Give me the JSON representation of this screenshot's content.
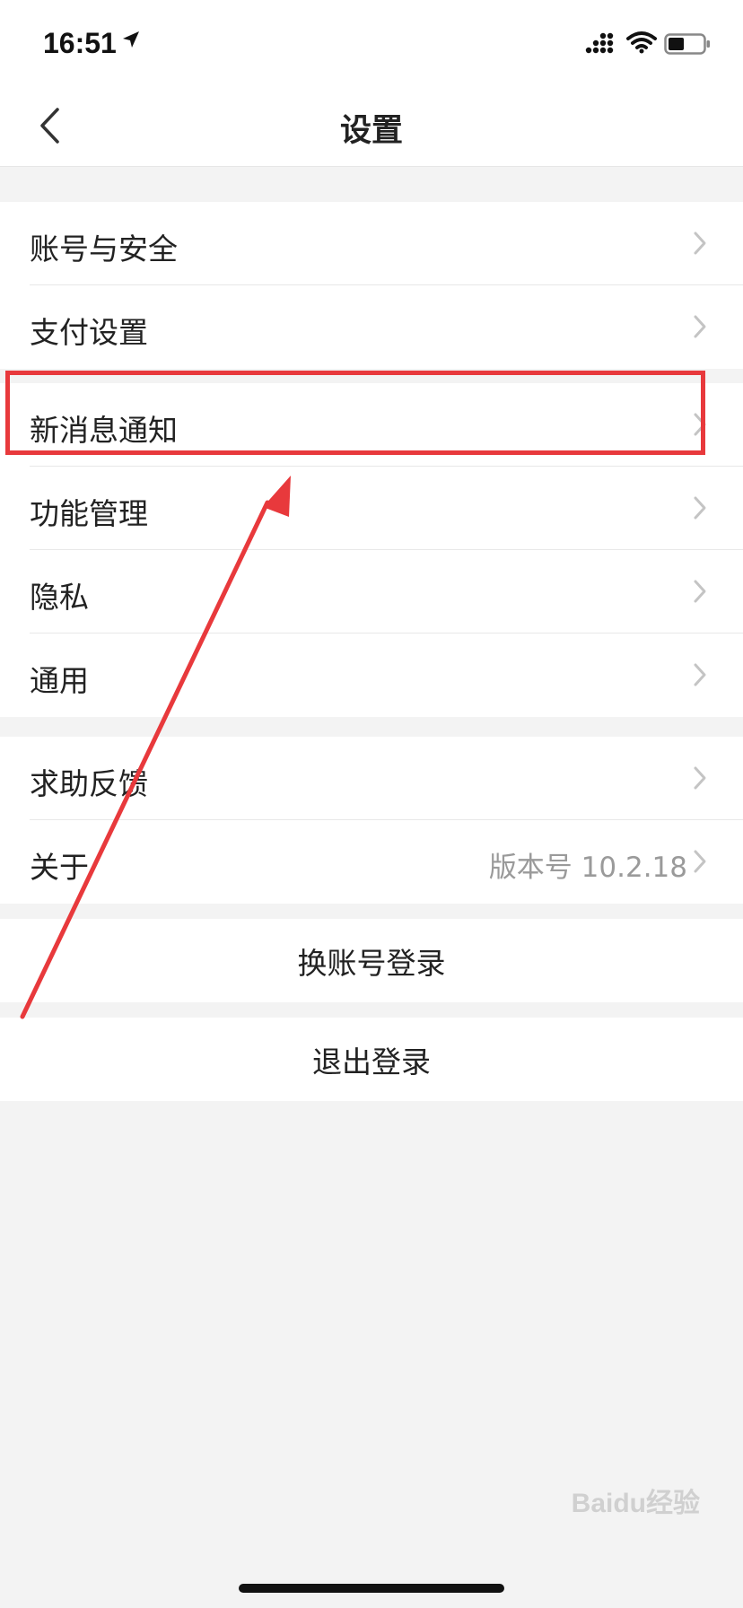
{
  "status_bar": {
    "time": "16:51",
    "icons": [
      "location-arrow-icon",
      "cellular-signal-icon",
      "wifi-icon",
      "battery-icon"
    ]
  },
  "nav": {
    "title": "设置",
    "back_icon": "chevron-left-icon"
  },
  "settings_groups": [
    {
      "items": [
        {
          "label": "账号与安全",
          "value": ""
        },
        {
          "label": "支付设置",
          "value": ""
        }
      ]
    },
    {
      "items": [
        {
          "label": "新消息通知",
          "value": ""
        },
        {
          "label": "功能管理",
          "value": ""
        },
        {
          "label": "隐私",
          "value": ""
        },
        {
          "label": "通用",
          "value": ""
        }
      ]
    },
    {
      "items": [
        {
          "label": "求助反馈",
          "value": ""
        },
        {
          "label": "关于",
          "value": "版本号 10.2.18"
        }
      ]
    }
  ],
  "actions": {
    "switch_account": "换账号登录",
    "logout": "退出登录"
  },
  "annotation": {
    "highlight_color": "#e8393c"
  },
  "watermark": {
    "text": "Baidu经验"
  },
  "colors": {
    "background": "#f3f3f3",
    "card": "#ffffff",
    "text": "#222222",
    "secondary_text": "#9a9a9a",
    "chevron": "#c4c4c4"
  }
}
